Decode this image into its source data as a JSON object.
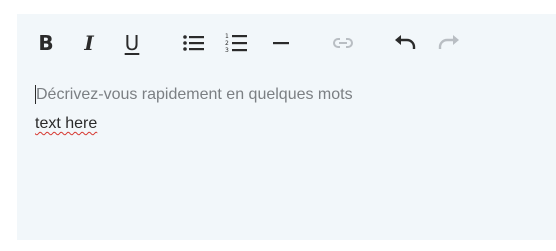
{
  "toolbar": {
    "bold": {
      "label": "B",
      "icon": "bold-icon"
    },
    "italic": {
      "label": "I",
      "icon": "italic-icon"
    },
    "underline": {
      "label": "U",
      "icon": "underline-icon"
    },
    "bulleted_list": {
      "icon": "bulleted-list-icon"
    },
    "numbered_list": {
      "icon": "numbered-list-icon"
    },
    "horizontal_rule": {
      "icon": "horizontal-rule-icon"
    },
    "link": {
      "icon": "link-icon",
      "disabled": true
    },
    "undo": {
      "icon": "undo-icon"
    },
    "redo": {
      "icon": "redo-icon",
      "disabled": true
    }
  },
  "editor": {
    "placeholder": "Décrivez-vous rapidement en quelques mots",
    "text": "text here"
  },
  "colors": {
    "editor_background": "#f2f7fa",
    "icon_active": "#2b2b2b",
    "icon_disabled": "#b9bec3",
    "placeholder_text": "#7b7f83",
    "spellcheck_underline": "#d6372f"
  }
}
